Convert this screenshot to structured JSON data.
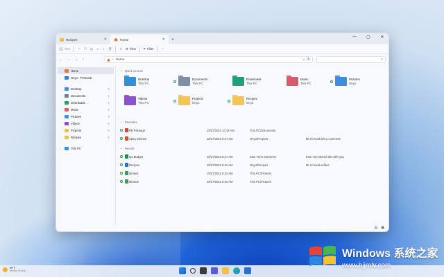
{
  "window": {
    "tabs": [
      {
        "label": "Recipes",
        "active": false
      },
      {
        "label": "Home",
        "active": true
      }
    ],
    "controls": [
      "—",
      "▢",
      "✕"
    ]
  },
  "toolbar": {
    "new_label": "New",
    "view_label": "View",
    "filter_label": "Filter",
    "more_label": "···"
  },
  "address": {
    "path": "Home",
    "search_placeholder": ""
  },
  "sidebar": {
    "items": [
      {
        "label": "Home",
        "icon": "home-icon",
        "color": "#e8743b",
        "selected": true
      },
      {
        "label": "Onyu - Personal",
        "icon": "onedrive-icon",
        "color": "#2f7de1"
      },
      {
        "label": "Desktop",
        "icon": "desktop-icon",
        "color": "#3a8ee6",
        "pinned": true
      },
      {
        "label": "Documents",
        "icon": "documents-icon",
        "color": "#6b7d99",
        "pinned": true
      },
      {
        "label": "Downloads",
        "icon": "downloads-icon",
        "color": "#1ea35c",
        "pinned": true
      },
      {
        "label": "Music",
        "icon": "music-icon",
        "color": "#e0586b",
        "pinned": true
      },
      {
        "label": "Pictures",
        "icon": "pictures-icon",
        "color": "#3a8ee6",
        "pinned": true
      },
      {
        "label": "Videos",
        "icon": "videos-icon",
        "color": "#8a4bd6",
        "pinned": true
      },
      {
        "label": "Projects",
        "icon": "folder-icon",
        "color": "#f2c04a",
        "pinned": true
      },
      {
        "label": "Recipes",
        "icon": "folder-icon",
        "color": "#f2c04a",
        "pinned": true
      },
      {
        "label": "This PC",
        "icon": "pc-icon",
        "color": "#3a8ee6"
      }
    ]
  },
  "quick_access": {
    "heading": "Quick access",
    "items": [
      {
        "name": "Desktop",
        "sub": "This PC",
        "color": "#2f8fd8",
        "sync": false
      },
      {
        "name": "Documents",
        "sub": "This PC",
        "color": "#7f8ea6",
        "sync": true
      },
      {
        "name": "Downloads",
        "sub": "This PC",
        "color": "#1aa37a",
        "sync": false
      },
      {
        "name": "Music",
        "sub": "This PC",
        "color": "#d95a6a",
        "sync": false
      },
      {
        "name": "Pictures",
        "sub": "Onyu",
        "color": "#3c8fe0",
        "sync": true
      },
      {
        "name": "Videos",
        "sub": "This PC",
        "color": "#8b4fd8",
        "sync": false
      },
      {
        "name": "Projects",
        "sub": "Onyu",
        "color": "#f3c553",
        "sync": true
      },
      {
        "name": "Recipes",
        "sub": "Onyu",
        "color": "#f3c553",
        "sync": true
      }
    ]
  },
  "favorites": {
    "heading": "Favorites",
    "rows": [
      {
        "name": "PB Package",
        "date": "10/27/2022 10:14 AM",
        "location": "This PC\\Documents",
        "activity": "",
        "color": "#d44a3a"
      },
      {
        "name": "Spicy Kitchen",
        "date": "10/27/2022 9:17 AM",
        "location": "Onyu\\Projects",
        "activity": "Mi Hi Kwak left a comment",
        "color": "#d44a3a"
      }
    ]
  },
  "recent": {
    "heading": "Recent",
    "rows": [
      {
        "name": "Q2 Budget",
        "date": "10/27/2022 8:47 AM",
        "location": "Eion Yoo's OneDrive",
        "activity": "Eion Yoo shared this with you",
        "color": "#1f8a4c"
      },
      {
        "name": "Recipes",
        "date": "10/27/2022 8:32 AM",
        "location": "Onyu\\Recipes",
        "activity": "Mi Hi Kwak edited",
        "color": "#2f6fd0"
      },
      {
        "name": "dinner1",
        "date": "10/27/2022 8:32 AM",
        "location": "This PC\\Pictures",
        "activity": "",
        "color": "#3a9a5c"
      },
      {
        "name": "dinner2",
        "date": "10/27/2022 8:32 AM",
        "location": "This PC\\Pictures",
        "activity": "",
        "color": "#3a9a5c"
      }
    ]
  },
  "taskbar": {
    "weather_temp": "66°F",
    "weather_desc": "Mostly Sunny",
    "apps": [
      "start-icon",
      "search-icon",
      "taskview-icon",
      "chat-icon",
      "explorer-icon",
      "edge-icon",
      "store-icon"
    ]
  },
  "watermark": {
    "title": "Windows 系统之家",
    "url": "www.bjjmlv.com"
  }
}
